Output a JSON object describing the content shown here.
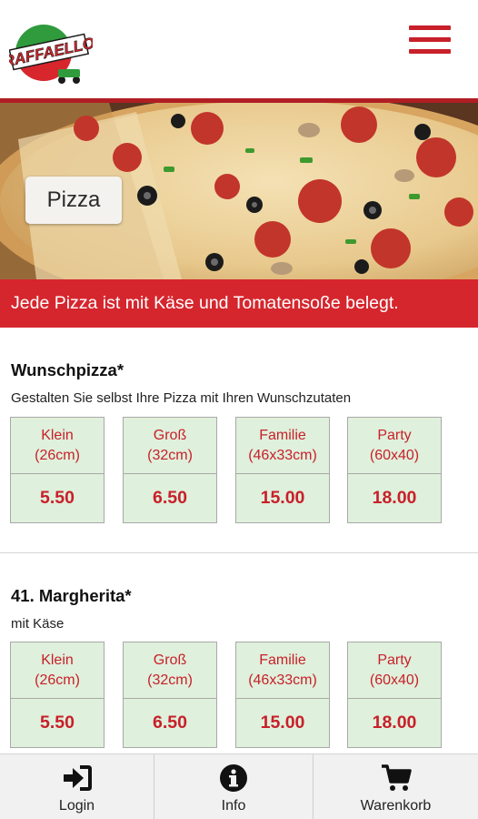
{
  "header": {
    "logo_text": "RAFFAELLO",
    "menu_icon": "hamburger-menu-icon",
    "accent_color": "#c8202a"
  },
  "hero": {
    "category_label": "Pizza"
  },
  "notice": {
    "text": "Jede Pizza ist mit Käse und Tomatensoße belegt.",
    "background": "#d5262e"
  },
  "products": [
    {
      "title": "Wunschpizza*",
      "description": "Gestalten Sie selbst Ihre Pizza mit Ihren Wunschzutaten",
      "sizes": [
        {
          "name": "Klein",
          "dimension": "(26cm)",
          "price": "5.50"
        },
        {
          "name": "Groß",
          "dimension": "(32cm)",
          "price": "6.50"
        },
        {
          "name": "Familie",
          "dimension": "(46x33cm)",
          "price": "15.00"
        },
        {
          "name": "Party",
          "dimension": "(60x40)",
          "price": "18.00"
        }
      ]
    },
    {
      "title": "41. Margherita*",
      "description": "mit Käse",
      "sizes": [
        {
          "name": "Klein",
          "dimension": "(26cm)",
          "price": "5.50"
        },
        {
          "name": "Groß",
          "dimension": "(32cm)",
          "price": "6.50"
        },
        {
          "name": "Familie",
          "dimension": "(46x33cm)",
          "price": "15.00"
        },
        {
          "name": "Party",
          "dimension": "(60x40)",
          "price": "18.00"
        }
      ]
    }
  ],
  "bottom_nav": [
    {
      "label": "Login",
      "icon": "login-icon"
    },
    {
      "label": "Info",
      "icon": "info-icon"
    },
    {
      "label": "Warenkorb",
      "icon": "shopping-cart-icon"
    }
  ],
  "colors": {
    "size_button_bg": "#dff0dc",
    "price_text": "#c8202a"
  }
}
